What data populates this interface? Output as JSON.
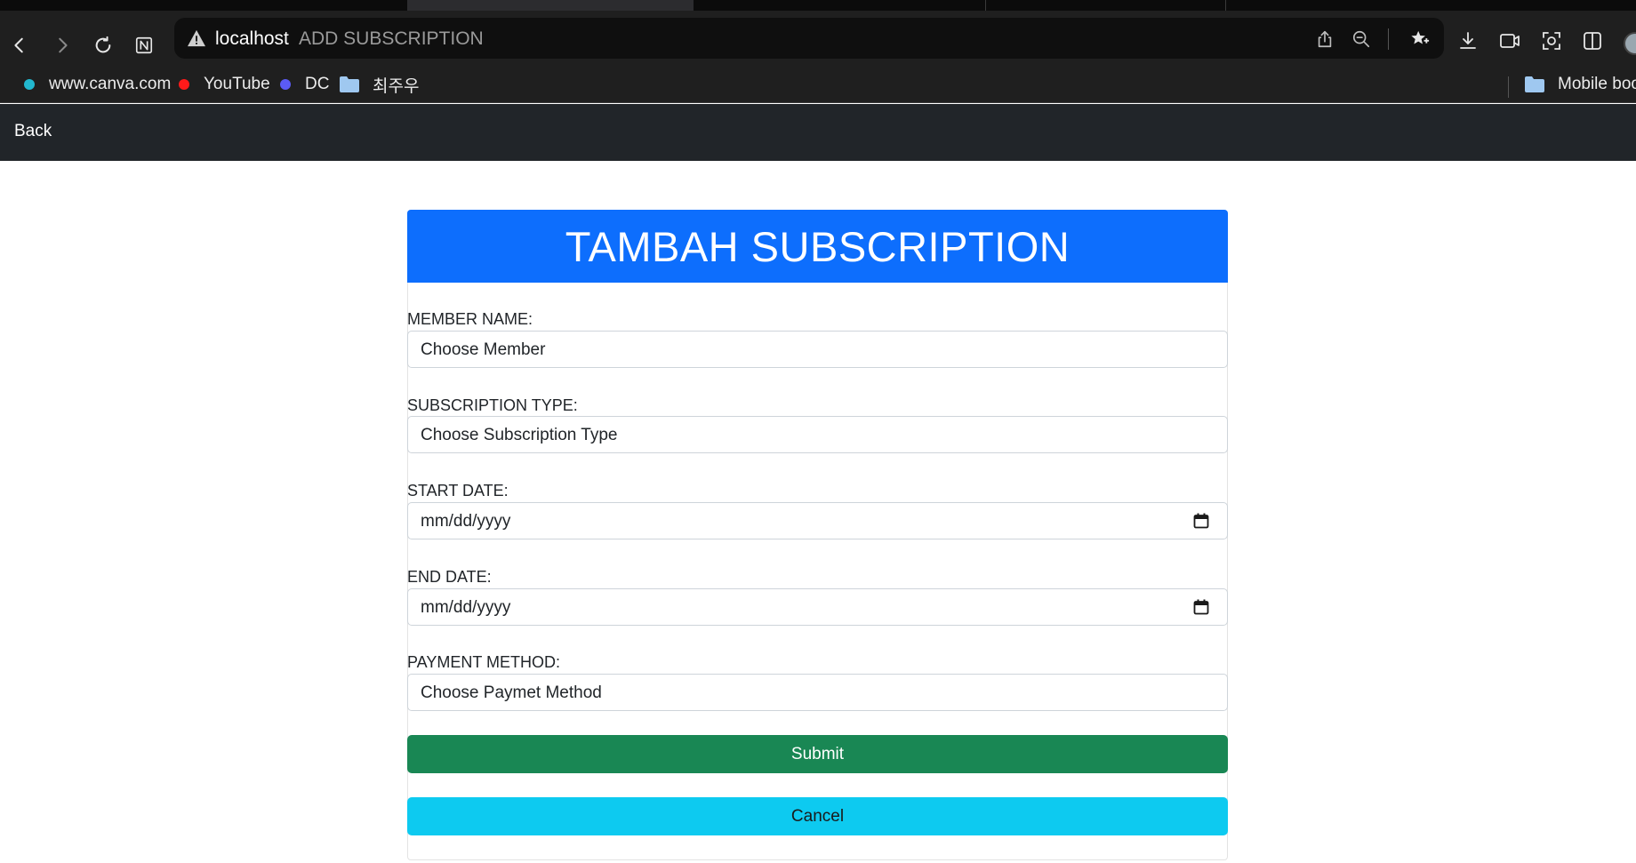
{
  "browser": {
    "address": {
      "host": "localhost",
      "page_title": "ADD SUBSCRIPTION"
    },
    "bookmarks": [
      {
        "label": "www.canva.com",
        "color": "#22b8cf"
      },
      {
        "label": "YouTube",
        "color": "#ff1a1a"
      },
      {
        "label": "DC",
        "color": "#5b5bf5"
      },
      {
        "label": "최주우",
        "icon": "folder-icon"
      }
    ],
    "bookmarks_right": {
      "label": "Mobile boo",
      "icon": "folder-icon"
    }
  },
  "navbar": {
    "back_label": "Back"
  },
  "form": {
    "title": "TAMBAH SUBSCRIPTION",
    "fields": [
      {
        "label": "MEMBER NAME:",
        "value": "Choose Member"
      },
      {
        "label": "SUBSCRIPTION TYPE:",
        "value": "Choose Subscription Type"
      },
      {
        "label": "START DATE:",
        "value": "mm/dd/yyyy"
      },
      {
        "label": "END DATE:",
        "value": "mm/dd/yyyy"
      },
      {
        "label": "PAYMENT METHOD:",
        "value": "Choose Paymet Method"
      }
    ],
    "submit_label": "Submit",
    "cancel_label": "Cancel"
  },
  "colors": {
    "header_blue": "#0d6efd",
    "submit_green": "#198754",
    "cancel_cyan": "#0dcaf0",
    "navbar_dark": "#212529"
  }
}
